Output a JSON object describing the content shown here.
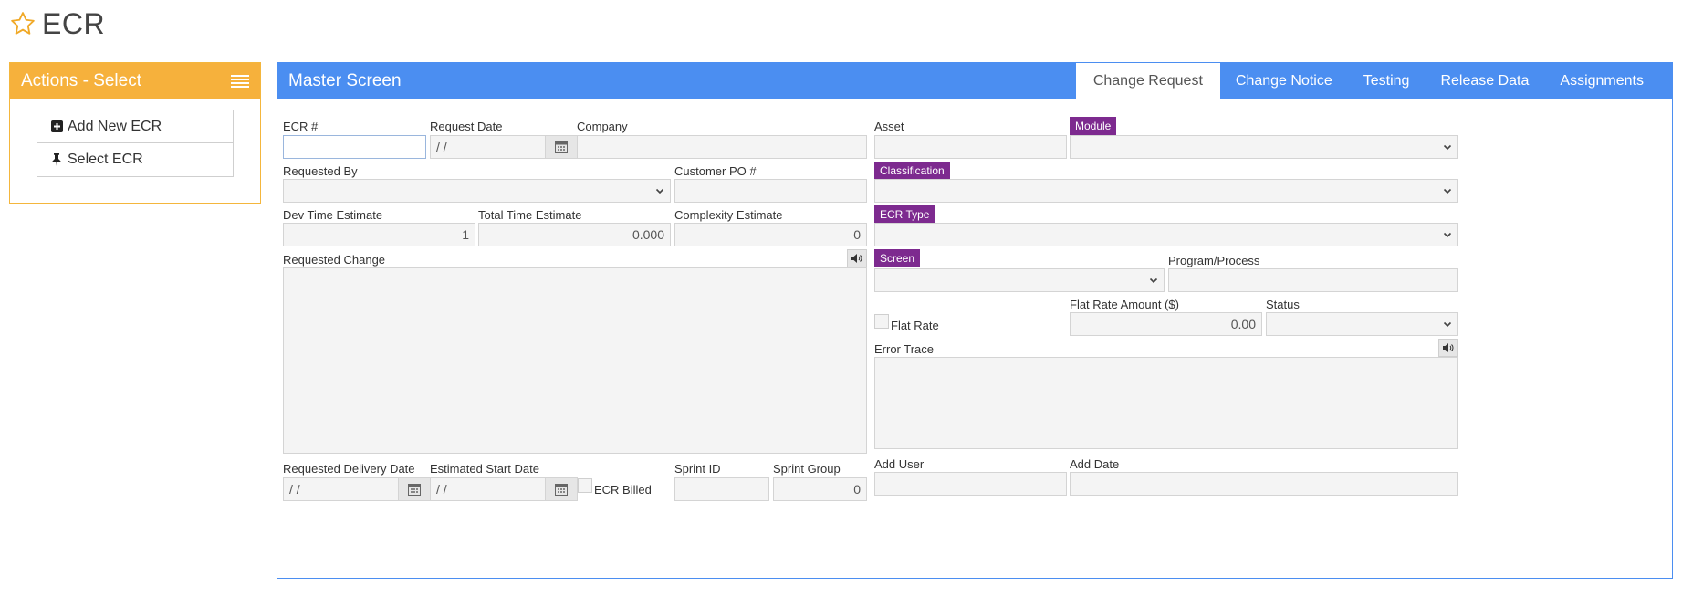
{
  "page": {
    "title": "ECR",
    "star_icon": "star-outline-icon",
    "accent": "#f6b13c"
  },
  "actions": {
    "title": "Actions - Select",
    "items": [
      {
        "label": "Add New ECR",
        "icon": "plus-square-icon"
      },
      {
        "label": "Select ECR",
        "icon": "pushpin-icon"
      }
    ]
  },
  "master": {
    "title": "Master Screen",
    "header_color": "#4b8ef1",
    "tabs": [
      "Change Request",
      "Change Notice",
      "Testing",
      "Release Data",
      "Assignments"
    ],
    "active_tab": "Change Request"
  },
  "form": {
    "ecr_no": {
      "label": "ECR #",
      "value": ""
    },
    "request_date": {
      "label": "Request Date",
      "value": " / /"
    },
    "company": {
      "label": "Company",
      "value": ""
    },
    "asset": {
      "label": "Asset",
      "value": ""
    },
    "module": {
      "label": "Module",
      "value": ""
    },
    "requested_by": {
      "label": "Requested By",
      "value": ""
    },
    "customer_po": {
      "label": "Customer PO #",
      "value": ""
    },
    "classification": {
      "label": "Classification",
      "value": ""
    },
    "dev_time": {
      "label": "Dev Time Estimate",
      "value": "1"
    },
    "total_time": {
      "label": "Total Time Estimate",
      "value": "0.000"
    },
    "complexity": {
      "label": "Complexity Estimate",
      "value": "0"
    },
    "ecr_type": {
      "label": "ECR Type",
      "value": ""
    },
    "requested_change": {
      "label": "Requested Change",
      "value": ""
    },
    "screen": {
      "label": "Screen",
      "value": ""
    },
    "program_process": {
      "label": "Program/Process",
      "value": ""
    },
    "flat_rate": {
      "label": "Flat Rate",
      "checked": false
    },
    "flat_rate_amount": {
      "label": "Flat Rate Amount ($)",
      "value": "0.00"
    },
    "status": {
      "label": "Status",
      "value": ""
    },
    "error_trace": {
      "label": "Error Trace",
      "value": ""
    },
    "requested_delivery": {
      "label": "Requested Delivery Date",
      "value": " / /"
    },
    "estimated_start": {
      "label": "Estimated Start Date",
      "value": " / /"
    },
    "ecr_billed": {
      "label": "ECR Billed",
      "checked": false
    },
    "sprint_id": {
      "label": "Sprint ID",
      "value": ""
    },
    "sprint_group": {
      "label": "Sprint Group",
      "value": "0"
    },
    "add_user": {
      "label": "Add User",
      "value": ""
    },
    "add_date": {
      "label": "Add Date",
      "value": ""
    }
  },
  "colors": {
    "tag": "#7d2a8f",
    "field_bg": "#f4f4f4"
  }
}
